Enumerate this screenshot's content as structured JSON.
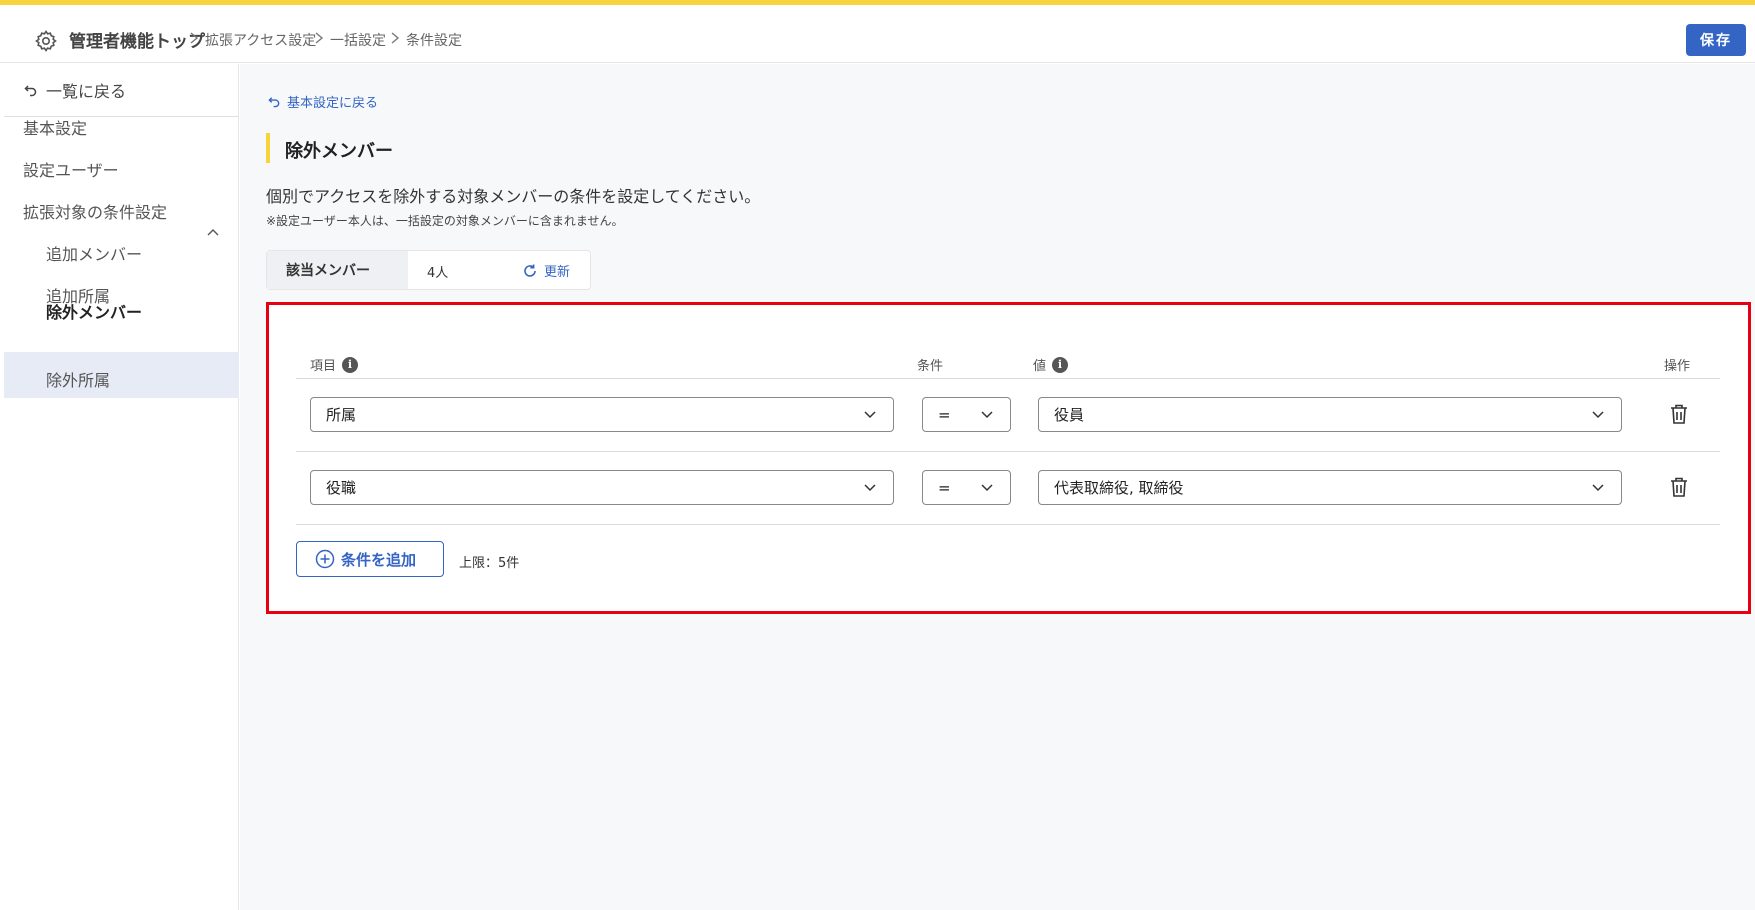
{
  "header": {
    "breadcrumb_top": "管理者機能トップ",
    "breadcrumb_1": "拡張アクセス設定",
    "breadcrumb_2": "一括設定",
    "breadcrumb_3": "条件設定",
    "save_label": "保存"
  },
  "sidebar": {
    "back_label": "一覧に戻る",
    "items": [
      "基本設定",
      "設定ユーザー",
      "拡張対象の条件設定"
    ],
    "sub_items": [
      "追加メンバー",
      "追加所属",
      "除外メンバー",
      "除外所属"
    ],
    "active": "除外メンバー"
  },
  "main": {
    "back_link": "基本設定に戻る",
    "title": "除外メンバー",
    "description": "個別でアクセスを除外する対象メンバーの条件を設定してください。",
    "note": "※設定ユーザー本人は、一括設定の対象メンバーに含まれません。",
    "count": {
      "label": "該当メンバー",
      "value": "4人",
      "refresh": "更新"
    }
  },
  "conditions": {
    "headers": {
      "item": "項目",
      "operator": "条件",
      "value": "値",
      "action": "操作"
    },
    "rows": [
      {
        "item": "所属",
        "operator": "=",
        "value": "役員"
      },
      {
        "item": "役職",
        "operator": "=",
        "value": "代表取締役, 取締役"
      }
    ],
    "add_label": "条件を追加",
    "limit": "上限：5件"
  },
  "colors": {
    "accent": "#3464c4",
    "highlight": "#e60012",
    "brand_yellow": "#f7d33c"
  }
}
